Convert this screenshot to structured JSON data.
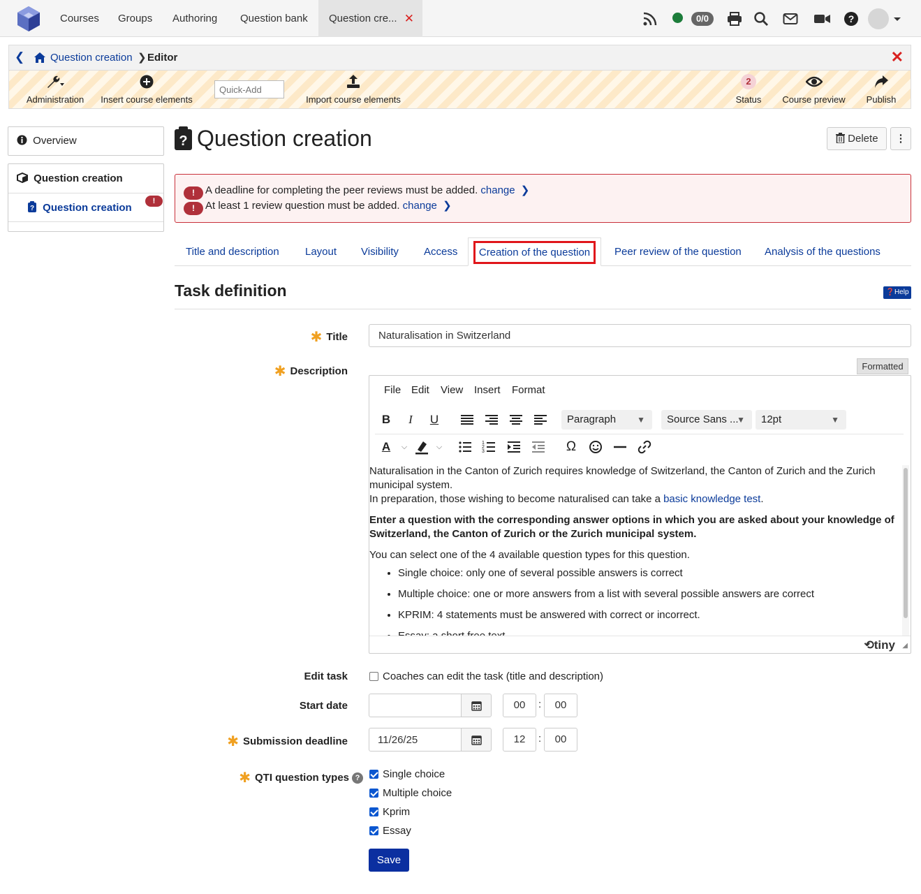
{
  "topnav": {
    "items": [
      "Courses",
      "Groups",
      "Authoring",
      "Question bank"
    ],
    "active_tab": "Question cre...",
    "badge": "0/0"
  },
  "breadcrumb": {
    "parent": "Question creation",
    "current": "Editor"
  },
  "toolbar": {
    "administration": "Administration",
    "insert": "Insert course elements",
    "quickadd_placeholder": "Quick-Add",
    "import": "Import course elements",
    "status_count": "2",
    "status": "Status",
    "preview": "Course preview",
    "publish": "Publish"
  },
  "sidebar": {
    "overview": "Overview",
    "section": "Question creation",
    "item": "Question creation"
  },
  "page": {
    "title": "Question creation",
    "delete": "Delete"
  },
  "alerts": [
    {
      "text": "A deadline for completing the peer reviews must be added.",
      "link": "change"
    },
    {
      "text": "At least 1 review question must be added.",
      "link": "change"
    }
  ],
  "tabs": [
    "Title and description",
    "Layout",
    "Visibility",
    "Access",
    "Creation of the question",
    "Peer review of the question",
    "Analysis of the questions"
  ],
  "section": {
    "title": "Task definition",
    "help": "Help"
  },
  "form": {
    "title_label": "Title",
    "title_value": "Naturalisation in Switzerland",
    "description_label": "Description",
    "formatted": "Formatted",
    "edit_task_label": "Edit task",
    "edit_task_option": "Coaches can edit the task (title and description)",
    "start_date_label": "Start date",
    "start_date_value": "",
    "start_hour": "00",
    "start_minute": "00",
    "deadline_label": "Submission deadline",
    "deadline_value": "11/26/25",
    "deadline_hour": "12",
    "deadline_minute": "00",
    "qti_label": "QTI question types",
    "qti_types": [
      "Single choice",
      "Multiple choice",
      "Kprim",
      "Essay"
    ],
    "save": "Save"
  },
  "editor": {
    "menu": [
      "File",
      "Edit",
      "View",
      "Insert",
      "Format"
    ],
    "block_format": "Paragraph",
    "font_family": "Source Sans ...",
    "font_size": "12pt",
    "para1": "Naturalisation in the Canton of Zurich requires knowledge of Switzerland, the Canton of Zurich and the Zurich municipal system.",
    "para2_prefix": "In preparation, those wishing to become naturalised can take a ",
    "para2_link": "basic knowledge test",
    "para2_suffix": ".",
    "bold_para": "Enter a question with the corresponding answer options in which you are asked about your knowledge of Switzerland, the Canton of Zurich or the Zurich municipal system.",
    "para3": "You can select one of the 4 available question types for this question.",
    "bullets": [
      "Single choice: only one of several possible answers is correct",
      "Multiple choice: one or more answers from a list with several possible answers are correct",
      "KPRIM: 4 statements must be answered with correct or incorrect.",
      "Essay: a short free text"
    ],
    "brand": "tiny"
  }
}
